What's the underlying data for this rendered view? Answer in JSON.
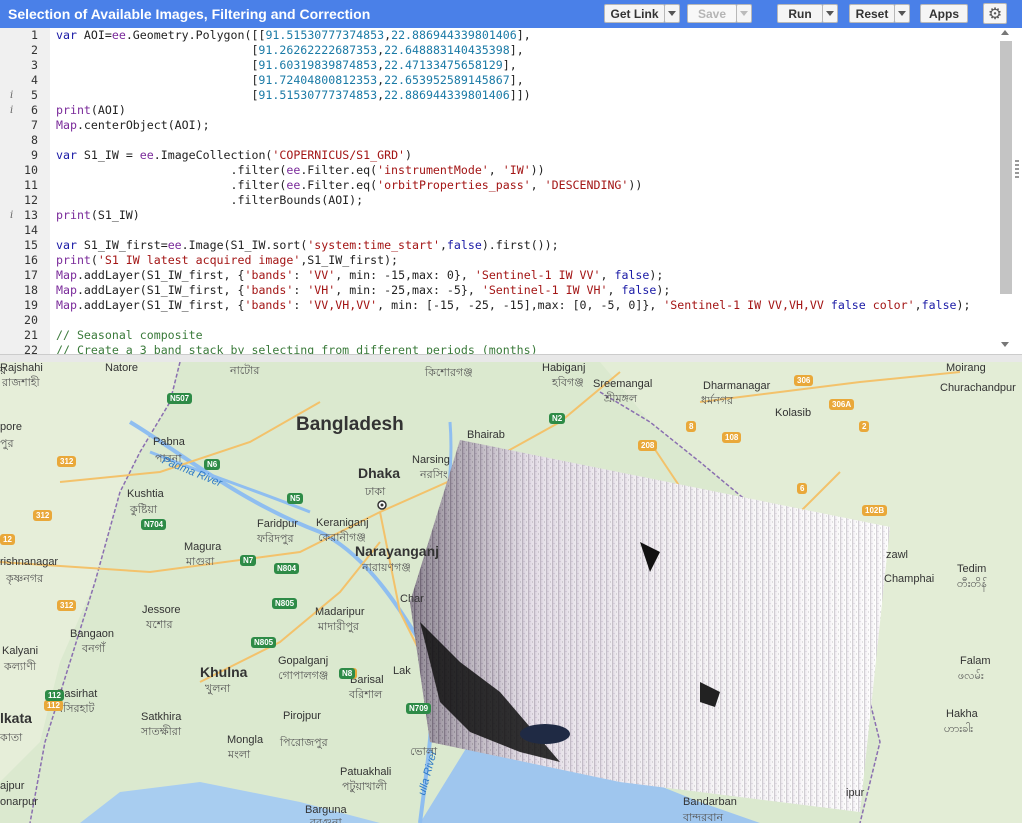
{
  "app": {
    "title": "Selection of Available Images, Filtering and Correction"
  },
  "toolbar": {
    "get_link": "Get Link",
    "save": "Save",
    "run": "Run",
    "reset": "Reset",
    "apps": "Apps",
    "settings_icon": "gear-icon"
  },
  "editor": {
    "lines": [
      {
        "n": "1",
        "text": "var AOI=ee.Geometry.Polygon([[91.51530777374853,22.886944339801406],"
      },
      {
        "n": "2",
        "text": "                            [91.26262222687353,22.648883140435398],"
      },
      {
        "n": "3",
        "text": "                            [91.60319839874853,22.47133475658129],"
      },
      {
        "n": "4",
        "text": "                            [91.72404800812353,22.653952589145867],"
      },
      {
        "n": "5",
        "text": "                            [91.51530777374853,22.886944339801406]])"
      },
      {
        "n": "6",
        "text": "print(AOI)"
      },
      {
        "n": "7",
        "text": "Map.centerObject(AOI);"
      },
      {
        "n": "8",
        "text": ""
      },
      {
        "n": "9",
        "text": "var S1_IW = ee.ImageCollection('COPERNICUS/S1_GRD')"
      },
      {
        "n": "10",
        "text": "                         .filter(ee.Filter.eq('instrumentMode', 'IW'))"
      },
      {
        "n": "11",
        "text": "                         .filter(ee.Filter.eq('orbitProperties_pass', 'DESCENDING'))"
      },
      {
        "n": "12",
        "text": "                         .filterBounds(AOI);"
      },
      {
        "n": "13",
        "text": "print(S1_IW)"
      },
      {
        "n": "14",
        "text": ""
      },
      {
        "n": "15",
        "text": "var S1_IW_first=ee.Image(S1_IW.sort('system:time_start',false).first());"
      },
      {
        "n": "16",
        "text": "print('S1 IW latest acquired image',S1_IW_first);"
      },
      {
        "n": "17",
        "text": "Map.addLayer(S1_IW_first, {'bands': 'VV', min: -15,max: 0}, 'Sentinel-1 IW VV', false);"
      },
      {
        "n": "18",
        "text": "Map.addLayer(S1_IW_first, {'bands': 'VH', min: -25,max: -5}, 'Sentinel-1 IW VH', false);"
      },
      {
        "n": "19",
        "text": "Map.addLayer(S1_IW_first, {'bands': 'VV,VH,VV', min: [-15, -25, -15],max: [0, -5, 0]}, 'Sentinel-1 IW VV,VH,VV false color',false);"
      },
      {
        "n": "20",
        "text": ""
      },
      {
        "n": "21",
        "text": "// Seasonal composite"
      },
      {
        "n": "22",
        "text": "// Create a 3 band stack by selecting from different periods (months)"
      }
    ]
  },
  "map": {
    "labels": [
      {
        "id": "bangladesh",
        "text": "Bangladesh"
      },
      {
        "id": "dhaka",
        "text": "Dhaka"
      },
      {
        "id": "dhaka_bn",
        "text": "ঢাকা"
      },
      {
        "id": "rajshahi",
        "text": "Rajshahi"
      },
      {
        "id": "rajshahi_bn",
        "text": "রাজশাহী"
      },
      {
        "id": "pabna",
        "text": "Pabna"
      },
      {
        "id": "pabna_bn",
        "text": "পাবনা"
      },
      {
        "id": "kushtia",
        "text": "Kushtia"
      },
      {
        "id": "kushtia_bn",
        "text": "কুষ্টিয়া"
      },
      {
        "id": "faridpur",
        "text": "Faridpur"
      },
      {
        "id": "faridpur_bn",
        "text": "ফরিদপুর"
      },
      {
        "id": "keraniganj",
        "text": "Keraniganj"
      },
      {
        "id": "keraniganj_bn",
        "text": "কেরানীগঞ্জ"
      },
      {
        "id": "narayanganj",
        "text": "Narayanganj"
      },
      {
        "id": "narayanganj_bn",
        "text": "নারায়ণগঞ্জ"
      },
      {
        "id": "narsingdi",
        "text": "Narsing"
      },
      {
        "id": "narsingdi_bn",
        "text": "নরসিং"
      },
      {
        "id": "bhairab",
        "text": "Bhairab"
      },
      {
        "id": "magura",
        "text": "Magura"
      },
      {
        "id": "magura_bn",
        "text": "মাগুরা"
      },
      {
        "id": "jessore",
        "text": "Jessore"
      },
      {
        "id": "jessore_bn",
        "text": "যশোর"
      },
      {
        "id": "madaripur",
        "text": "Madaripur"
      },
      {
        "id": "madaripur_bn",
        "text": "মাদারীপুর"
      },
      {
        "id": "khulna",
        "text": "Khulna"
      },
      {
        "id": "khulna_bn",
        "text": "খুলনা"
      },
      {
        "id": "gopalganj",
        "text": "Gopalganj"
      },
      {
        "id": "gopalganj_bn",
        "text": "গোপালগঞ্জ"
      },
      {
        "id": "bangaon",
        "text": "Bangaon"
      },
      {
        "id": "bangaon_bn",
        "text": "বনগাঁ"
      },
      {
        "id": "kalyani",
        "text": "Kalyani"
      },
      {
        "id": "kalyani_bn",
        "text": "কল্যাণী"
      },
      {
        "id": "krishnanagar",
        "text": "rishnanagar"
      },
      {
        "id": "krishnanagar_bn",
        "text": "কৃষ্ণনগর"
      },
      {
        "id": "kolkata",
        "text": "lkata"
      },
      {
        "id": "kolkata_bn",
        "text": "কাতা"
      },
      {
        "id": "basirhat",
        "text": "Basirhat"
      },
      {
        "id": "basirhat_bn",
        "text": "বসিরহাট"
      },
      {
        "id": "satkhira",
        "text": "Satkhira"
      },
      {
        "id": "satkhira_bn",
        "text": "সাতক্ষীরা"
      },
      {
        "id": "pirojpur",
        "text": "Pirojpur"
      },
      {
        "id": "pirojpur_bn",
        "text": "পিরোজপুর"
      },
      {
        "id": "mongla",
        "text": "Mongla"
      },
      {
        "id": "mongla_bn",
        "text": "মংলা"
      },
      {
        "id": "barisal",
        "text": "Barisal"
      },
      {
        "id": "barisal_bn",
        "text": "বরিশাল"
      },
      {
        "id": "patuakhali",
        "text": "Patuakhali"
      },
      {
        "id": "patuakhali_bn",
        "text": "পটুয়াখালী"
      },
      {
        "id": "barguna",
        "text": "Barguna"
      },
      {
        "id": "barguna_bn",
        "text": "বরগুনা"
      },
      {
        "id": "baruipur",
        "text": "ajpur"
      },
      {
        "id": "baruipur2",
        "text": "onarpur"
      },
      {
        "id": "habiganj",
        "text": "Habiganj"
      },
      {
        "id": "habiganj_bn",
        "text": "হবিগঞ্জ"
      },
      {
        "id": "sreemangal",
        "text": "Sreemangal"
      },
      {
        "id": "sreemangal_bn",
        "text": "শ্রীমঙ্গল"
      },
      {
        "id": "dharmanagar",
        "text": "Dharmanagar"
      },
      {
        "id": "dharmanagar_bn",
        "text": "ধর্মনগর"
      },
      {
        "id": "kolasib",
        "text": "Kolasib"
      },
      {
        "id": "moirang",
        "text": "Moirang"
      },
      {
        "id": "churachandpur",
        "text": "Churachandpur"
      },
      {
        "id": "aizawl",
        "text": "zawl"
      },
      {
        "id": "champhai",
        "text": "Champhai"
      },
      {
        "id": "tedim",
        "text": "Tedim"
      },
      {
        "id": "tedim_bn",
        "text": "တီးတိန်"
      },
      {
        "id": "falam",
        "text": "Falam"
      },
      {
        "id": "falam_bn",
        "text": "ဖလမ်း"
      },
      {
        "id": "hakha",
        "text": "Hakha"
      },
      {
        "id": "hakha_bn",
        "text": "ဟားခါး"
      },
      {
        "id": "bandarban",
        "text": "Bandarban"
      },
      {
        "id": "bandarban_bn",
        "text": "বান্দরবান"
      },
      {
        "id": "kishoreganj_bn",
        "text": "কিশোরগঞ্জ"
      },
      {
        "id": "natore",
        "text": "Natore"
      },
      {
        "id": "natore_bn",
        "text": "নাটোর"
      },
      {
        "id": "padma",
        "text": "Padma River"
      },
      {
        "id": "meghna",
        "text": "ulla River"
      },
      {
        "id": "bhola_bn",
        "text": "ভোলা"
      },
      {
        "id": "char",
        "text": "Char"
      },
      {
        "id": "lak",
        "text": "Lak"
      },
      {
        "id": "pore",
        "text": "pore"
      },
      {
        "id": "pore_bn",
        "text": "পুর"
      },
      {
        "id": "kalyani2",
        "text": "র"
      },
      {
        "id": "dudhpur",
        "text": "ipur"
      }
    ],
    "roads": [
      "N507",
      "N2",
      "N6",
      "N5",
      "N704",
      "N7",
      "N804",
      "N805",
      "N805",
      "N8",
      "N709",
      "306",
      "306A",
      "208",
      "8",
      "108",
      "2",
      "6",
      "102B",
      "312",
      "312",
      "312",
      "112",
      "112",
      "12",
      "N8"
    ]
  }
}
